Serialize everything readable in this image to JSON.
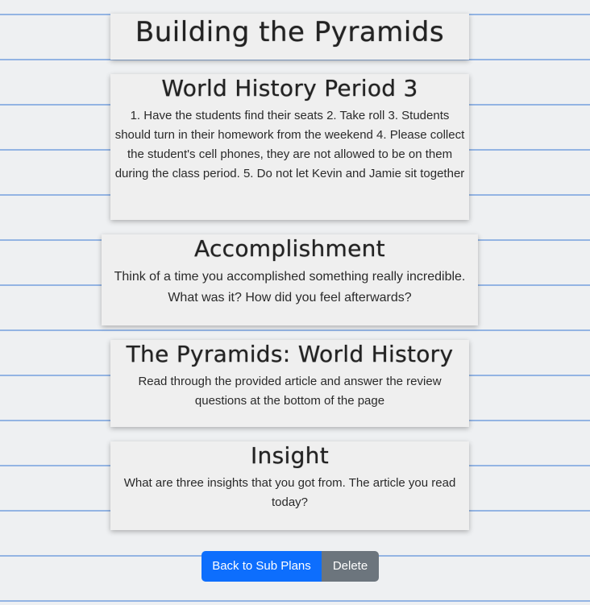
{
  "page_title": "Building the Pyramids",
  "sections": [
    {
      "heading": "World History Period 3",
      "body": "1. Have the students find their seats 2. Take roll 3. Students should turn in their homework from the weekend 4. Please collect the student's cell phones, they are not allowed to be on them during the class period. 5. Do not let Kevin and Jamie sit together"
    },
    {
      "heading": "Accomplishment",
      "body": "Think of a time you accomplished something really incredible. What was it? How did you feel afterwards?"
    },
    {
      "heading": "The Pyramids: World History",
      "body": "Read through the provided article and answer the review questions at the bottom of the page"
    },
    {
      "heading": "Insight",
      "body": "What are three insights that you got from. The article you read today?"
    }
  ],
  "buttons": {
    "back_label": "Back to Sub Plans",
    "delete_label": "Delete"
  },
  "colors": {
    "primary": "#0d6efd",
    "secondary": "#6c757d",
    "notebook_line": "#93b4e3",
    "card_bg": "#efefef"
  }
}
